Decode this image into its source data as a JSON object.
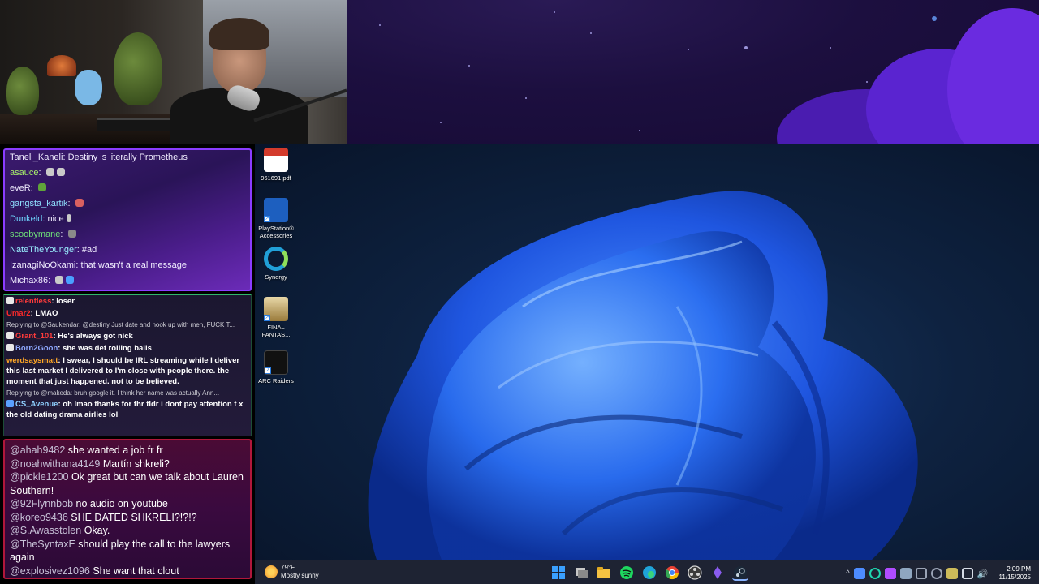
{
  "chat_top": {
    "messages": [
      {
        "user": "Taneli_Kaneli",
        "color": "#f0ecff",
        "text": "Destiny is literally Prometheus"
      },
      {
        "user": "asauce",
        "color": "#a8f06a",
        "text": ""
      },
      {
        "user": "eveR",
        "color": "#ffffff",
        "text": ""
      },
      {
        "user": "gangsta_kartik",
        "color": "#8fe0ff",
        "text": ""
      },
      {
        "user": "Dunkeld",
        "color": "#6fd6ff",
        "text": "nice"
      },
      {
        "user": "scoobymane",
        "color": "#6fe07a",
        "text": ""
      },
      {
        "user": "NateTheYounger",
        "color": "#9af0ff",
        "text": "#ad"
      },
      {
        "user": "IzanagiNoOkami",
        "color": "#f0ecff",
        "text": "that wasn't a real message"
      },
      {
        "user": "Michax86",
        "color": "#ffffff",
        "text": ""
      }
    ]
  },
  "chat_mid": {
    "lines": [
      {
        "kind": "msg",
        "user": "relentless",
        "color": "#ff3b3b",
        "text": "loser"
      },
      {
        "kind": "msg",
        "user": "Umar2",
        "color": "#ff2a2a",
        "text": "LMAO"
      },
      {
        "kind": "reply",
        "text": "Replying to @Saukendar: @destiny Just date and hook up with men, FUCK T..."
      },
      {
        "kind": "msg",
        "user": "Grant_101",
        "color": "#ff3b3b",
        "text": "He's always got nick"
      },
      {
        "kind": "msg",
        "user": "Born2Goon",
        "color": "#8fa8ff",
        "text": "she was def rolling balls"
      },
      {
        "kind": "msg",
        "user": "werdsaysmatt",
        "color": "#ffa726",
        "text": "I swear, I should be IRL streaming while I deliver this last market I delivered to I'm close with people there. the moment that just happened. not to be believed."
      },
      {
        "kind": "reply",
        "text": "Replying to @makeda: bruh google it. I think her name was actually Ann..."
      },
      {
        "kind": "msg",
        "user": "CS_Avenue",
        "color": "#8fd0ff",
        "text": "oh lmao thanks for thr tldr i dont pay attention t x the old dating drama airlies lol"
      }
    ]
  },
  "chat_bottom": {
    "messages": [
      {
        "handle": "@ahah9482",
        "text": "she wanted a job fr fr"
      },
      {
        "handle": "@noahwithana4149",
        "text": "Martín shkreli?"
      },
      {
        "handle": "@pickle1200",
        "text": "Ok great but can we talk about Lauren Southern!"
      },
      {
        "handle": "@92Flynnbob",
        "text": "no audio on youtube"
      },
      {
        "handle": "@koreo9436",
        "text": "SHE DATED SHKRELI?!?!?"
      },
      {
        "handle": "@S.Awasstolen",
        "text": "Okay."
      },
      {
        "handle": "@TheSyntaxE",
        "text": "should play the call to the lawyers again"
      },
      {
        "handle": "@explosivez1096",
        "text": "She want that clout"
      }
    ]
  },
  "desktop_icons": [
    {
      "name": "pdf-file-icon",
      "label": "961691.pdf",
      "color": "#d33b2c"
    },
    {
      "name": "playstation-accessories-icon",
      "label": "PlayStation® Accessories",
      "color": "#1d5fbf"
    },
    {
      "name": "synergy-icon",
      "label": "Synergy",
      "color": "#21a0d8"
    },
    {
      "name": "final-fantasy-icon",
      "label": "FINAL FANTAS...",
      "color": "#c9a85a"
    },
    {
      "name": "arc-raiders-icon",
      "label": "ARC Raiders",
      "color": "#222222"
    }
  ],
  "taskbar": {
    "weather_temp": "79°F",
    "weather_desc": "Mostly sunny",
    "apps": [
      {
        "name": "start-button",
        "color": "#3aa0ff"
      },
      {
        "name": "task-view-button",
        "color": "#c7c7c7"
      },
      {
        "name": "file-explorer-icon",
        "color": "#f5c242"
      },
      {
        "name": "spotify-icon",
        "color": "#1ed760"
      },
      {
        "name": "edge-icon",
        "color": "#1fa3d9"
      },
      {
        "name": "chrome-icon",
        "color": "#e94235"
      },
      {
        "name": "obs-icon",
        "color": "#3c3c3c"
      },
      {
        "name": "app-purple-icon",
        "color": "#8a5cf0"
      },
      {
        "name": "steam-icon",
        "color": "#1b2838"
      }
    ],
    "tray": [
      {
        "name": "chevron-up-icon",
        "color": "#2b3145"
      },
      {
        "name": "tray-app-blue-icon",
        "color": "#4d8cff"
      },
      {
        "name": "tray-app-green-icon",
        "color": "#1fd6b0"
      },
      {
        "name": "tray-app-purple-icon",
        "color": "#b04cff"
      },
      {
        "name": "tray-steam-icon",
        "color": "#8fa6c0"
      },
      {
        "name": "tray-app-gear-icon",
        "color": "#9aa3b5"
      },
      {
        "name": "tray-app-generic-icon",
        "color": "#9aa3b5"
      },
      {
        "name": "tray-app-yellow-icon",
        "color": "#cdbb5a"
      },
      {
        "name": "wifi-icon",
        "color": "#d6dbe6"
      },
      {
        "name": "volume-icon",
        "color": "#d6dbe6"
      }
    ],
    "time": "2:09 PM",
    "date": "11/15/2025"
  }
}
